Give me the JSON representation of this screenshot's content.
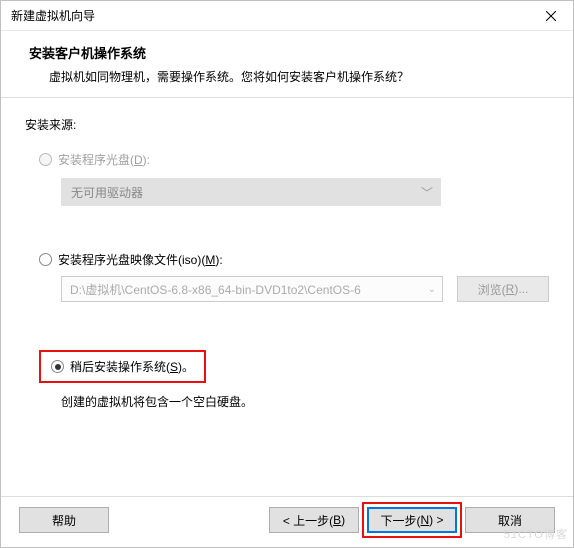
{
  "titlebar": {
    "title": "新建虚拟机向导"
  },
  "header": {
    "heading": "安装客户机操作系统",
    "subheading": "虚拟机如同物理机，需要操作系统。您将如何安装客户机操作系统？"
  },
  "content": {
    "source_label": "安装来源:",
    "option_disc": {
      "label_pre": "安装程序光盘(",
      "label_key": "D",
      "label_post": "):",
      "dropdown_text": "无可用驱动器"
    },
    "option_iso": {
      "label_pre": "安装程序光盘映像文件(iso)(",
      "label_key": "M",
      "label_post": "):",
      "path_value": "D:\\虚拟机\\CentOS-6.8-x86_64-bin-DVD1to2\\CentOS-6",
      "browse_pre": "浏览(",
      "browse_key": "R",
      "browse_post": ")..."
    },
    "option_later": {
      "label_pre": "稍后安装操作系统(",
      "label_key": "S",
      "label_post": ")。",
      "note": "创建的虚拟机将包含一个空白硬盘。"
    }
  },
  "footer": {
    "help": "帮助",
    "back_pre": "< 上一步(",
    "back_key": "B",
    "back_post": ")",
    "next_pre": "下一步(",
    "next_key": "N",
    "next_post": ") >",
    "cancel": "取消"
  },
  "watermark": "51CTO博客"
}
